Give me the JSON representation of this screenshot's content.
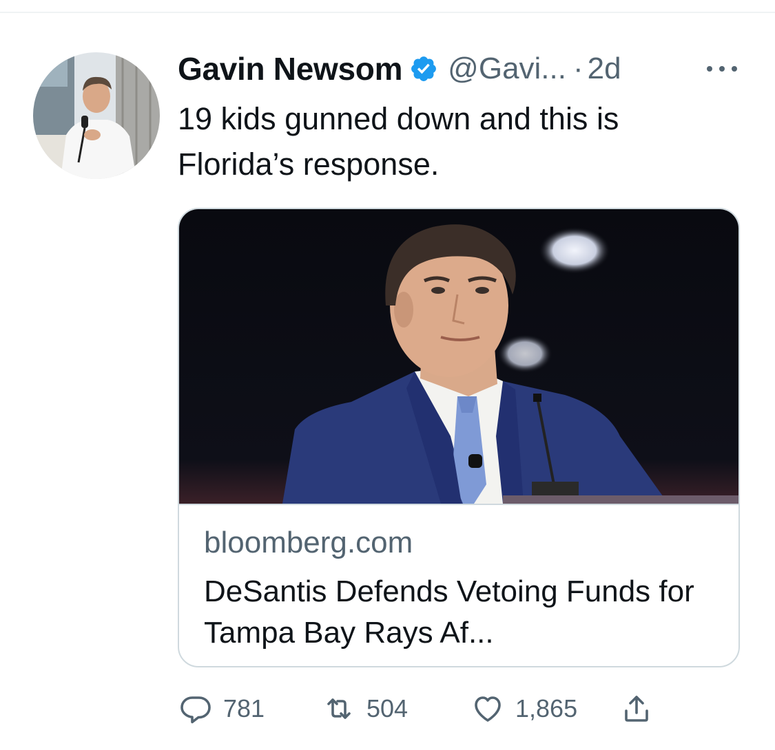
{
  "tweet": {
    "author": {
      "display_name": "Gavin Newsom",
      "handle": "@Gavi...",
      "verified_icon": "verified-badge-icon",
      "avatar_icon": "avatar-photo"
    },
    "separator": "·",
    "timestamp": "2d",
    "more_icon": "more-horizontal-icon",
    "text": "19 kids gunned down and this is Florida’s response.",
    "card": {
      "image_icon": "article-photo",
      "domain": "bloomberg.com",
      "title": "DeSantis Defends Vetoing Funds for Tampa Bay Rays Af..."
    },
    "actions": {
      "reply": {
        "icon": "reply-icon",
        "count": "781"
      },
      "retweet": {
        "icon": "retweet-icon",
        "count": "504"
      },
      "like": {
        "icon": "heart-icon",
        "count": "1,865"
      },
      "share": {
        "icon": "share-icon"
      }
    }
  },
  "colors": {
    "text_primary": "#0f1419",
    "text_secondary": "#536471",
    "verified_blue": "#1d9bf0",
    "border": "#cfd9de"
  }
}
